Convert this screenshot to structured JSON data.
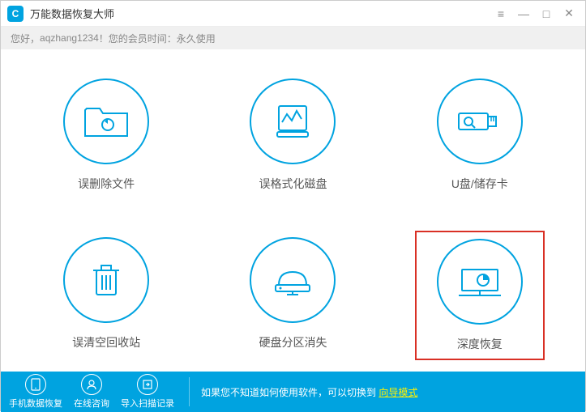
{
  "header": {
    "title": "万能数据恢复大师"
  },
  "userbar": {
    "greeting": "您好，",
    "username": "aqzhang1234",
    "suffix": "！您的会员时间：永久使用"
  },
  "options": [
    {
      "label": "误删除文件",
      "icon": "folder-refresh",
      "selected": false
    },
    {
      "label": "误格式化磁盘",
      "icon": "disk-format",
      "selected": false
    },
    {
      "label": "U盘/储存卡",
      "icon": "usb-card",
      "selected": false
    },
    {
      "label": "误清空回收站",
      "icon": "recycle-bin",
      "selected": false
    },
    {
      "label": "硬盘分区消失",
      "icon": "partition",
      "selected": false
    },
    {
      "label": "深度恢复",
      "icon": "deep-scan",
      "selected": true
    }
  ],
  "footer": {
    "buttons": [
      {
        "label": "手机数据恢复",
        "icon": "phone"
      },
      {
        "label": "在线咨询",
        "icon": "user"
      },
      {
        "label": "导入扫描记录",
        "icon": "import"
      }
    ],
    "tip_text": "如果您不知道如何使用软件，可以切换到 ",
    "tip_link": "向导模式"
  }
}
